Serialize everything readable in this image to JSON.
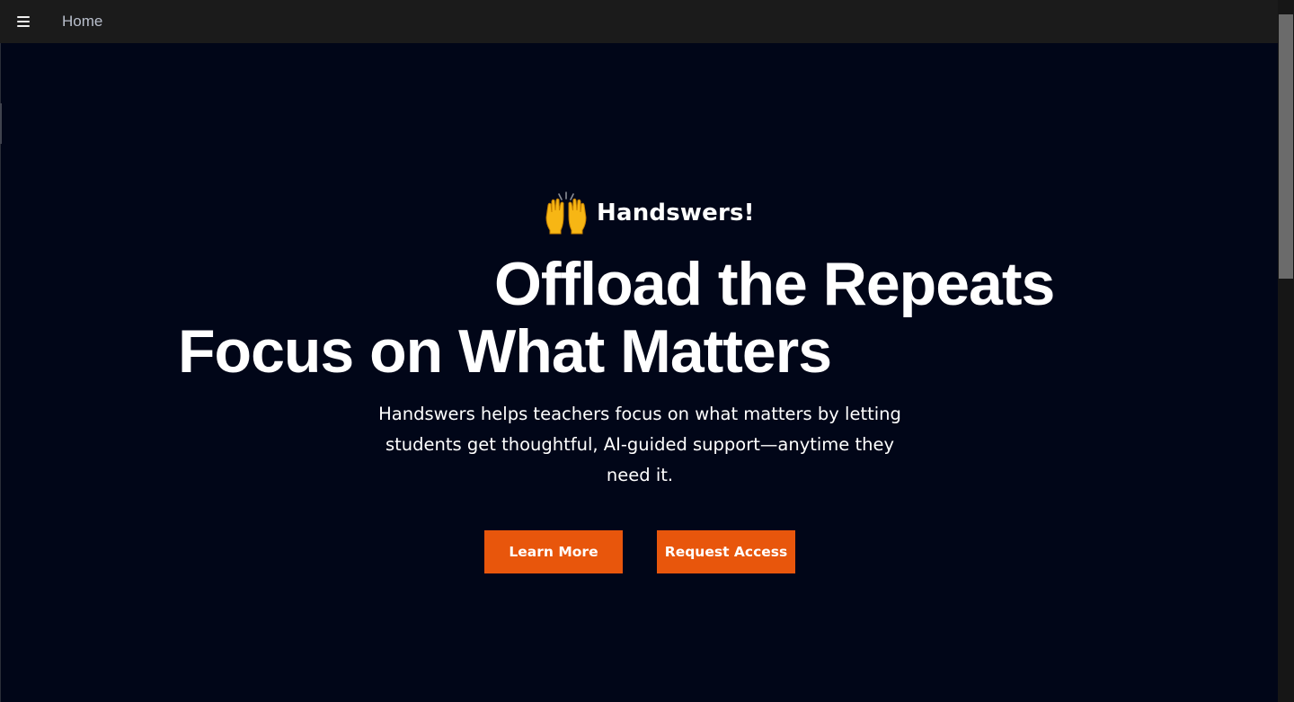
{
  "nav": {
    "menu_icon": "hamburger-menu-icon",
    "home_label": "Home"
  },
  "hero": {
    "brand_icon": "raising-hands-emoji",
    "brand_name": "Handswers!",
    "headline_line1": "Offload the Repeats",
    "headline_line2": "Focus on What Matters",
    "description": "Handswers helps teachers focus on what matters by letting students get thoughtful, AI-guided support—anytime they need it.",
    "primary_button": "Learn More",
    "secondary_button": "Request Access"
  },
  "colors": {
    "background": "#010618",
    "topbar": "#1b1b1b",
    "accent": "#e8560c",
    "text": "#ffffff",
    "nav_text": "#b9bfcc"
  }
}
